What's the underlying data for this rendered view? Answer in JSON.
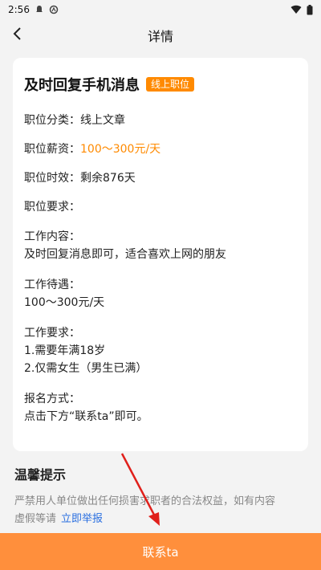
{
  "status_bar": {
    "time": "2:56",
    "icons": [
      "notification-icon",
      "circle-icon",
      "wifi-icon",
      "battery-icon"
    ]
  },
  "header": {
    "title": "详情",
    "back_icon": "chevron-left-icon"
  },
  "job": {
    "title": "及时回复手机消息",
    "badge": "线上职位",
    "category_label": "职位分类：",
    "category_value": "线上文章",
    "salary_label": "职位薪资：",
    "salary_value": "100～300元/天",
    "validity_label": "职位时效：",
    "validity_value": "剩余876天",
    "requirement_label": "职位要求：",
    "content_label": "工作内容：",
    "content_value": "及时回复消息即可，适合喜欢上网的朋友",
    "benefits_label": "工作待遇：",
    "benefits_value": "100～300元/天",
    "work_req_label": "工作要求：",
    "work_req_lines": [
      "1.需要年满18岁",
      "2.仅需女生（男生已满）"
    ],
    "apply_label": "报名方式：",
    "apply_value": "点击下方“联系ta”即可。"
  },
  "tips": {
    "title": "温馨提示",
    "text_line1": "严禁用人单位做出任何损害求职者的合法权益，如有内容",
    "text_line2": "虚假等请",
    "report_link": "立即举报"
  },
  "footer": {
    "contact_label": "联系ta"
  },
  "colors": {
    "accent": "#ff8a00",
    "button": "#ff8f3c",
    "link": "#2a6fe0",
    "annotation": "#e0201b"
  }
}
